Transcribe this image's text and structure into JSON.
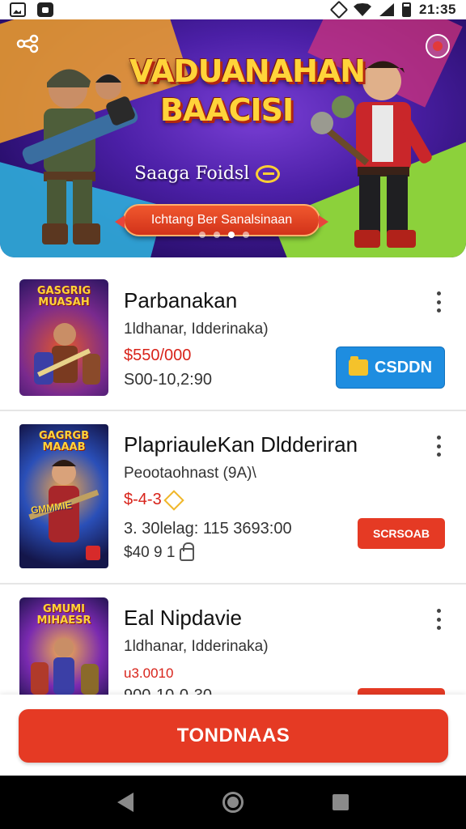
{
  "status_bar": {
    "time": "21:35"
  },
  "banner": {
    "title": "VADUANAHAN BAACISI",
    "subtitle": "Saaga Foidsl",
    "cta_label": "Ichtang Ber Sanalsinaan",
    "carousel_dots": 4,
    "active_dot": 2
  },
  "items": [
    {
      "thumb_text": "GASGRIG MUASAH",
      "title": "Parbanakan",
      "meta": "1ldhanar, Idderinaka)",
      "price": "$550/000",
      "date": "S00-10,2:90",
      "button_label": "CSDDN"
    },
    {
      "thumb_text": "GAGRGB MAAAB",
      "thumb_text2": "GMMMIE",
      "title": "PlapriauleKan Dldderiran",
      "meta": "Peootaohnast (9A)\\",
      "price": "$-4-3",
      "date": "3. 30lelag: 115 3693:00",
      "extra": "$40 9 1",
      "button_label": "SCRSOAB"
    },
    {
      "thumb_text": "GMUMI MIHAESR",
      "title": "Eal Nipdavie",
      "meta": "1ldhanar, Idderinaka)",
      "price": "u3.0010",
      "date": "900-10-0-30"
    }
  ],
  "bottom_cta": {
    "label": "TONDNAAS"
  },
  "colors": {
    "accent_red": "#e53a24",
    "accent_blue": "#1e8de0",
    "price_red": "#d8231a",
    "banner_purple": "#4b1fa6"
  },
  "icons": [
    "photo-icon",
    "cat-app-icon",
    "vibrate-icon",
    "wifi-icon",
    "signal-icon",
    "battery-icon",
    "share-icon",
    "favorite-icon",
    "folder-icon",
    "lock-icon",
    "kebab-menu-icon",
    "nav-back-icon",
    "nav-home-icon",
    "nav-recent-icon"
  ]
}
